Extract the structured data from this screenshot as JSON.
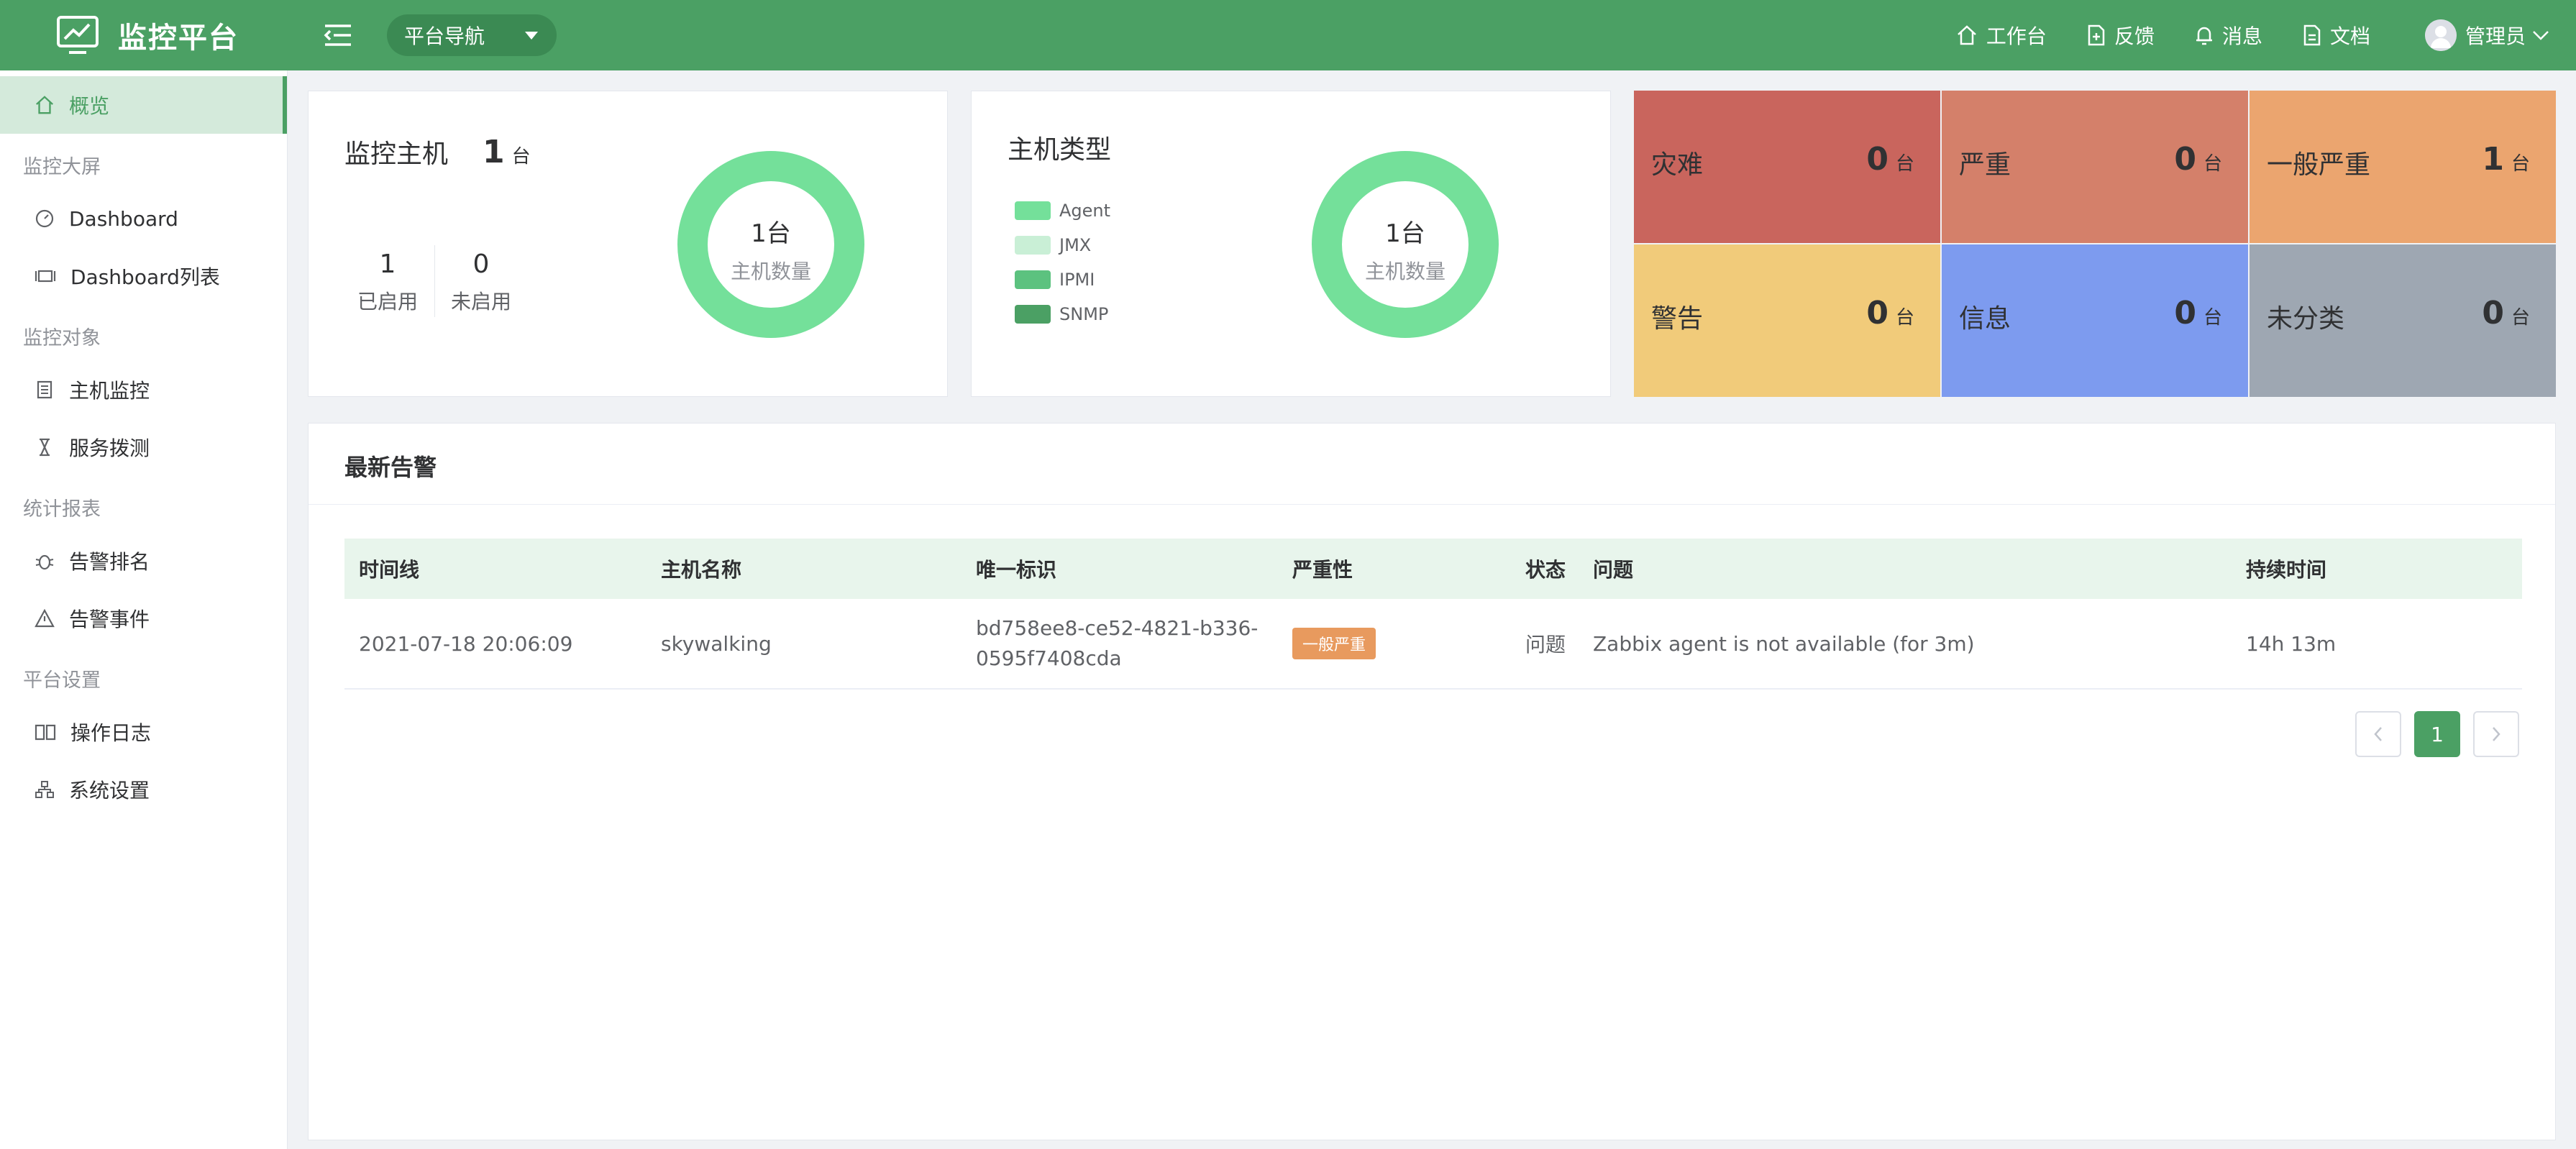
{
  "header": {
    "app_title": "监控平台",
    "nav_dropdown": "平台导航",
    "items": [
      {
        "label": "工作台",
        "icon": "home-icon"
      },
      {
        "label": "反馈",
        "icon": "feedback-icon"
      },
      {
        "label": "消息",
        "icon": "bell-icon"
      },
      {
        "label": "文档",
        "icon": "document-icon"
      }
    ],
    "user": "管理员"
  },
  "sidebar": {
    "overview": "概览",
    "groups": [
      {
        "title": "监控大屏",
        "items": [
          "Dashboard",
          "Dashboard列表"
        ]
      },
      {
        "title": "监控对象",
        "items": [
          "主机监控",
          "服务拨测"
        ]
      },
      {
        "title": "统计报表",
        "items": [
          "告警排名",
          "告警事件"
        ]
      },
      {
        "title": "平台设置",
        "items": [
          "操作日志",
          "系统设置"
        ]
      }
    ]
  },
  "hosts_card": {
    "title": "监控主机",
    "count": "1",
    "unit": "台",
    "enabled_value": "1",
    "enabled_label": "已启用",
    "disabled_value": "0",
    "disabled_label": "未启用",
    "donut_value": "1台",
    "donut_label": "主机数量",
    "donut_fraction": 1.0
  },
  "host_types_card": {
    "title": "主机类型",
    "legend": [
      {
        "name": "Agent",
        "color": "#74e09a"
      },
      {
        "name": "JMX",
        "color": "#c9efd6"
      },
      {
        "name": "IPMI",
        "color": "#5cc27f"
      },
      {
        "name": "SNMP",
        "color": "#4ba064"
      }
    ],
    "donut_value": "1台",
    "donut_label": "主机数量"
  },
  "severity": [
    {
      "name": "灾难",
      "value": "0",
      "unit": "台",
      "color": "#c9655d"
    },
    {
      "name": "严重",
      "value": "0",
      "unit": "台",
      "color": "#d4806a"
    },
    {
      "name": "一般严重",
      "value": "1",
      "unit": "台",
      "color": "#eba56f"
    },
    {
      "name": "警告",
      "value": "0",
      "unit": "台",
      "color": "#f1cb7a"
    },
    {
      "name": "信息",
      "value": "0",
      "unit": "台",
      "color": "#7d9bef"
    },
    {
      "name": "未分类",
      "value": "0",
      "unit": "台",
      "color": "#9ea7b2"
    }
  ],
  "alerts": {
    "title": "最新告警",
    "columns": [
      "时间线",
      "主机名称",
      "唯一标识",
      "严重性",
      "状态",
      "问题",
      "持续时间"
    ],
    "rows": [
      {
        "time": "2021-07-18 20:06:09",
        "host": "skywalking",
        "uid_line1": "bd758ee8-ce52-4821-b336-",
        "uid_line2": "0595f7408cda",
        "severity": "一般严重",
        "status": "问题",
        "problem": "Zabbix agent is not available (for 3m)",
        "duration": "14h 13m"
      }
    ],
    "pagination": {
      "prev": "<",
      "current": "1",
      "next": ">"
    }
  }
}
